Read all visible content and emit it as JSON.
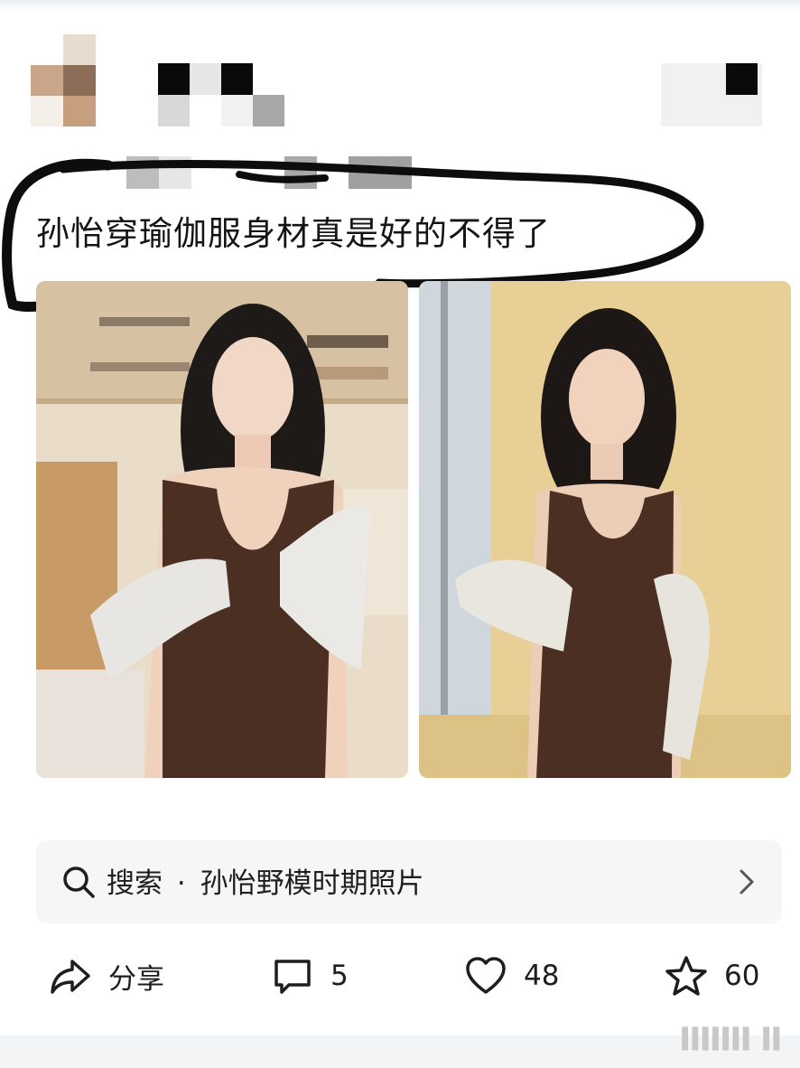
{
  "post": {
    "title": "孙怡穿瑜伽服身材真是好的不得了"
  },
  "search": {
    "prefix": "搜索",
    "separator": "·",
    "query": "孙怡野模时期照片"
  },
  "actions": {
    "share_label": "分享",
    "comment_count": "5",
    "like_count": "48",
    "favorite_count": "60"
  },
  "colors": {
    "scribble": "#0d0d0d",
    "top_wear": "#4a2f22",
    "backdrop_2": "#e7cf95"
  },
  "icons": [
    "share-icon",
    "comment-icon",
    "heart-icon",
    "star-icon",
    "search-icon",
    "chevron-right-icon"
  ]
}
